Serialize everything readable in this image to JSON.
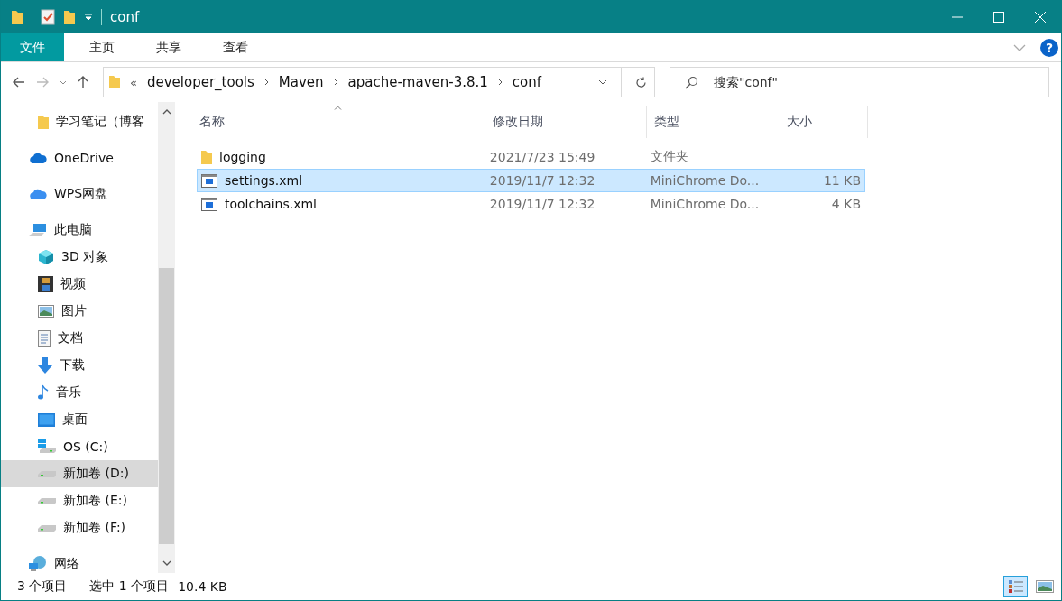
{
  "window": {
    "title": "conf"
  },
  "ribbon": {
    "tabs": [
      {
        "label": "文件",
        "kind": "file",
        "selected": false
      },
      {
        "label": "主页",
        "kind": "tab",
        "selected": false
      },
      {
        "label": "共享",
        "kind": "tab",
        "selected": false
      },
      {
        "label": "查看",
        "kind": "tab",
        "selected": false
      }
    ],
    "help": "?"
  },
  "address_bar": {
    "overflow": "«",
    "path": [
      "developer_tools",
      "Maven",
      "apache-maven-3.8.1",
      "conf"
    ]
  },
  "search": {
    "placeholder": "搜索\"conf\""
  },
  "sidebar": {
    "pinned_items": [
      {
        "label": "学习笔记（博客",
        "selected": false
      }
    ],
    "items": [
      {
        "label": "OneDrive",
        "selected": false
      },
      {
        "label": "WPS网盘",
        "selected": false
      },
      {
        "label": "此电脑",
        "selected": false,
        "children": [
          {
            "label": "3D 对象",
            "selected": false
          },
          {
            "label": "视频",
            "selected": false
          },
          {
            "label": "图片",
            "selected": false
          },
          {
            "label": "文档",
            "selected": false
          },
          {
            "label": "下载",
            "selected": false
          },
          {
            "label": "音乐",
            "selected": false
          },
          {
            "label": "桌面",
            "selected": false
          },
          {
            "label": "OS (C:)",
            "selected": false
          },
          {
            "label": "新加卷 (D:)",
            "selected": true
          },
          {
            "label": "新加卷 (E:)",
            "selected": false
          },
          {
            "label": "新加卷 (F:)",
            "selected": false
          }
        ]
      },
      {
        "label": "网络",
        "selected": false
      }
    ]
  },
  "table": {
    "columns": [
      "名称",
      "修改日期",
      "类型",
      "大小"
    ],
    "rows": [
      {
        "kind": "folder",
        "name": "logging",
        "modified": "2021/7/23 15:49",
        "type": "文件夹",
        "size": "",
        "selected": false
      },
      {
        "kind": "xml",
        "name": "settings.xml",
        "modified": "2019/11/7 12:32",
        "type": "MiniChrome Do...",
        "size": "11 KB",
        "selected": true
      },
      {
        "kind": "xml",
        "name": "toolchains.xml",
        "modified": "2019/11/7 12:32",
        "type": "MiniChrome Do...",
        "size": "4 KB",
        "selected": false
      }
    ]
  },
  "status_bar": {
    "item_count": "3 个项目",
    "selection": "选中 1 个项目",
    "selection_size": "10.4 KB",
    "views": [
      {
        "kind": "details",
        "selected": true
      },
      {
        "kind": "large_icons",
        "selected": false
      }
    ]
  }
}
